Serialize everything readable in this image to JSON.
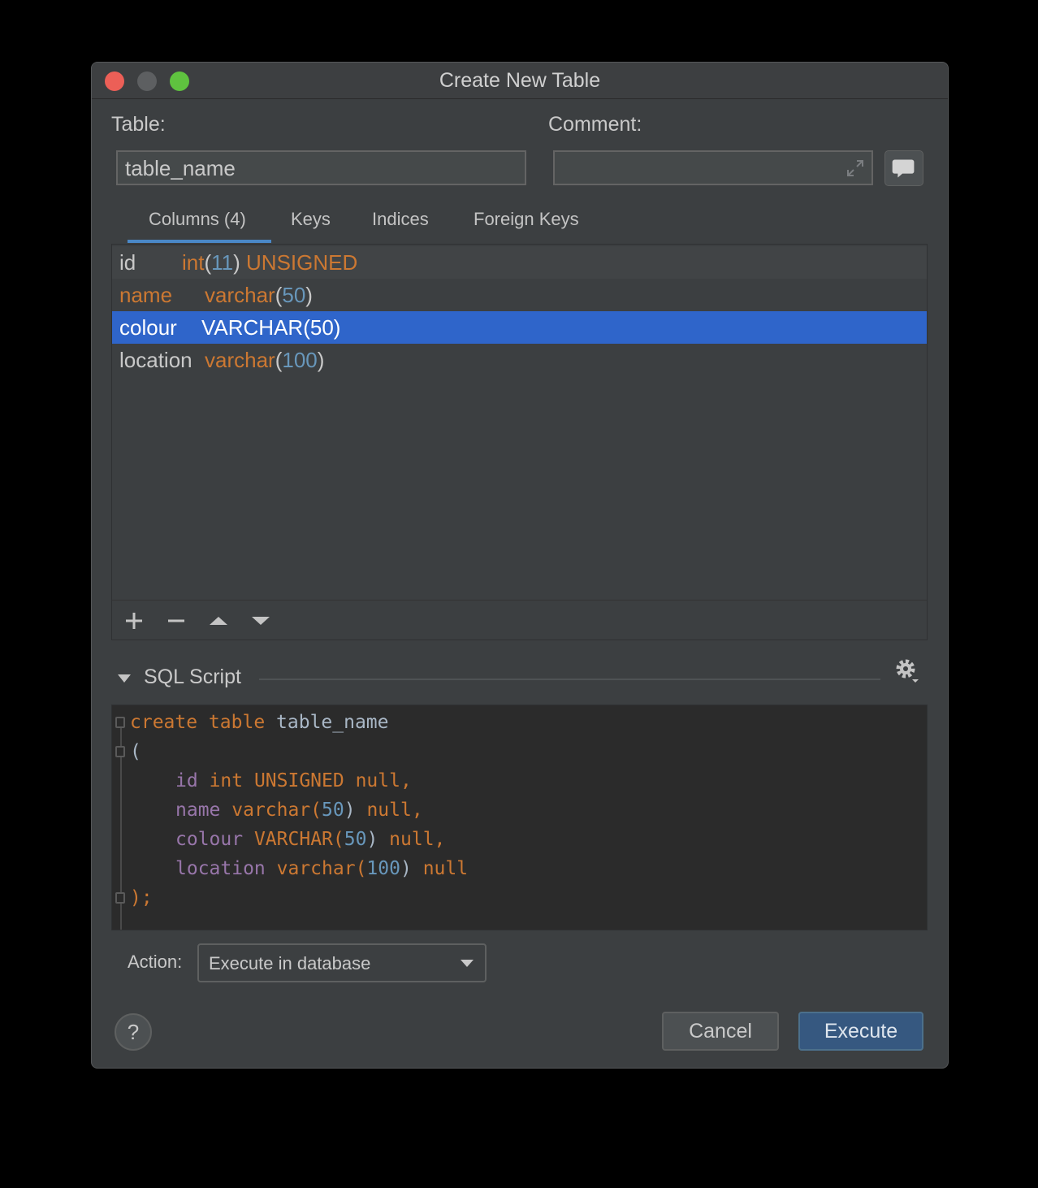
{
  "window": {
    "title": "Create New Table"
  },
  "form": {
    "table_label": "Table:",
    "table_value": "table_name",
    "comment_label": "Comment:",
    "comment_value": ""
  },
  "tabs": [
    {
      "label": "Columns (4)",
      "active": true
    },
    {
      "label": "Keys",
      "active": false
    },
    {
      "label": "Indices",
      "active": false
    },
    {
      "label": "Foreign Keys",
      "active": false
    }
  ],
  "columns": [
    {
      "name": "id",
      "type": "int",
      "size": "11",
      "extra": "UNSIGNED"
    },
    {
      "name": "name",
      "type": "varchar",
      "size": "50"
    },
    {
      "name": "colour",
      "type": "VARCHAR(50)",
      "selected": true
    },
    {
      "name": "location",
      "type": "varchar",
      "size": "100"
    }
  ],
  "sql_section": {
    "title": "SQL Script"
  },
  "sql": {
    "l1_kw": "create table",
    "l1_id": "table_name",
    "l2": "(",
    "l3_f": "id",
    "l3_t": "int UNSIGNED null,",
    "l4_f": "name",
    "l4_t": "varchar(",
    "l4_n": "50",
    "l4_c": ")",
    "l4_e": "null,",
    "l5_f": "colour",
    "l5_t": "VARCHAR(",
    "l5_n": "50",
    "l5_c": ")",
    "l5_e": "null,",
    "l6_f": "location",
    "l6_t": "varchar(",
    "l6_n": "100",
    "l6_c": ")",
    "l6_e": "null",
    "l7": ");"
  },
  "action": {
    "label": "Action:",
    "selected": "Execute in database"
  },
  "buttons": {
    "help": "?",
    "cancel": "Cancel",
    "execute": "Execute"
  },
  "colors": {
    "accent": "#2f65ca",
    "keyword": "#cc7832",
    "number": "#6897bb",
    "field": "#9876aa"
  }
}
